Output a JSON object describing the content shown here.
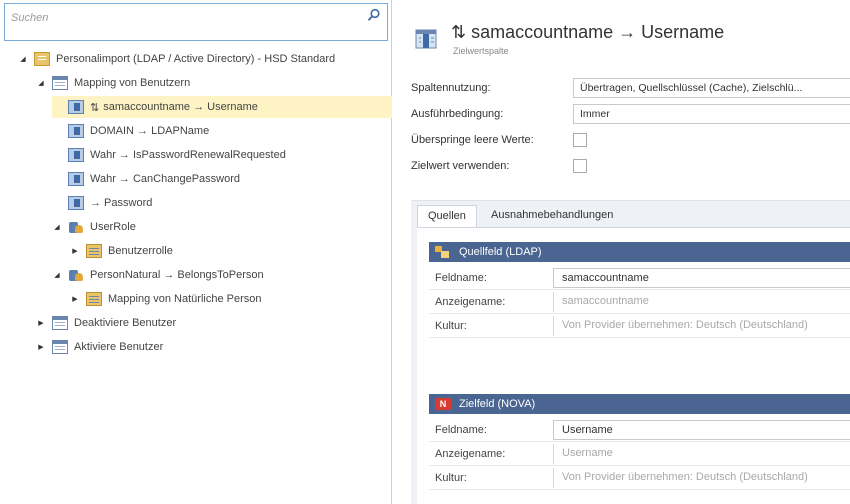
{
  "search": {
    "placeholder": "Suchen"
  },
  "tree": {
    "root": "Personalimport (LDAP / Active Directory) - HSD Standard",
    "mapping_users": "Mapping von Benutzern",
    "item_samaccount": "samaccountname → Username",
    "item_samaccount_prefix": "⇅",
    "item_domain": "DOMAIN → LDAPName",
    "item_wahr1": "Wahr → IsPasswordRenewalRequested",
    "item_wahr2": "Wahr → CanChangePassword",
    "item_password": "→ Password",
    "userrole": "UserRole",
    "benutzerrolle": "Benutzerrolle",
    "personnatural": "PersonNatural → BelongsToPerson",
    "mapping_natural": "Mapping von Natürliche Person",
    "deaktiviere": "Deaktiviere Benutzer",
    "aktiviere": "Aktiviere Benutzer"
  },
  "header": {
    "title": "⇅ samaccountname → Username",
    "subtitle": "Zielwertspalte"
  },
  "properties": {
    "spaltennutzung_label": "Spaltennutzung:",
    "spaltennutzung_value": "Übertragen, Quellschlüssel (Cache), Zielschlü...",
    "ausfuehrbedingung_label": "Ausführbedingung:",
    "ausfuehrbedingung_value": "Immer",
    "ueberspringe_label": "Überspringe leere Werte:",
    "zielwert_label": "Zielwert verwenden:"
  },
  "tabs": {
    "quellen": "Quellen",
    "ausnahme": "Ausnahmebehandlungen"
  },
  "source": {
    "header": "Quellfeld (LDAP)",
    "feldname_label": "Feldname:",
    "feldname_value": "samaccountname",
    "anzeigename_label": "Anzeigename:",
    "anzeigename_value": "samaccountname",
    "kultur_label": "Kultur:",
    "kultur_value": "Von Provider übernehmen: Deutsch (Deutschland)"
  },
  "target": {
    "header": "Zielfeld (NOVA)",
    "badge": "N",
    "feldname_label": "Feldname:",
    "feldname_value": "Username",
    "anzeigename_label": "Anzeigename:",
    "anzeigename_value": "Username",
    "kultur_label": "Kultur:",
    "kultur_value": "Von Provider übernehmen: Deutsch (Deutschland)"
  },
  "icons": {
    "search": "search-icon",
    "table": "table-icon",
    "import": "import-icon",
    "map": "mapping-icon",
    "role": "role-icon"
  },
  "colors": {
    "selected_row": "#fdf3c4",
    "group_header": "#4a6591",
    "tab_area": "#eef1f5",
    "search_border": "#7aa9d8"
  }
}
